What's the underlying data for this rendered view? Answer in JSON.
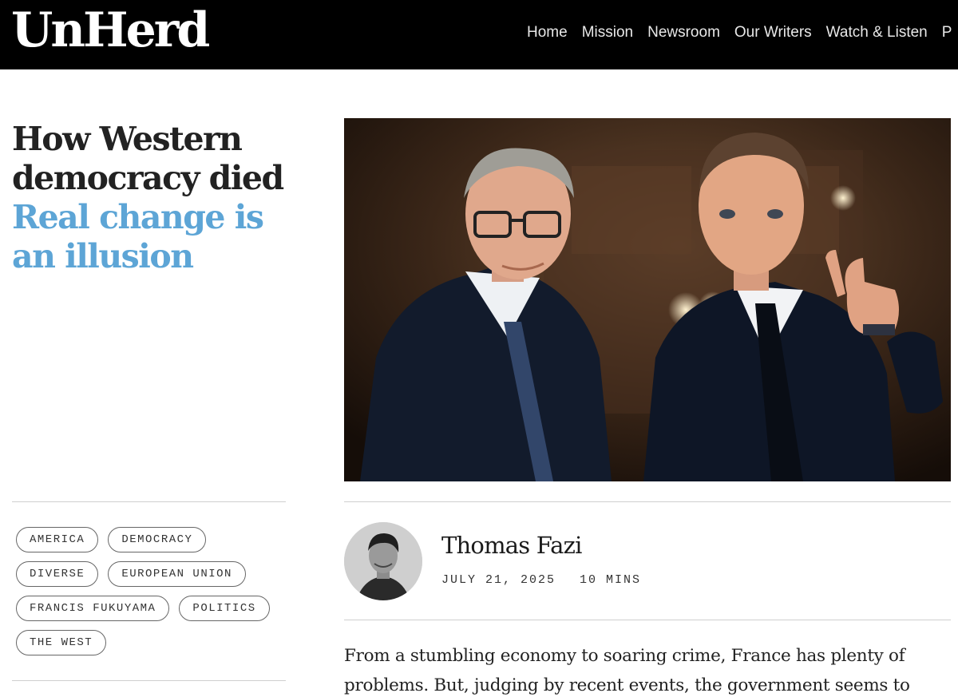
{
  "site": {
    "logo": "UnHerd"
  },
  "nav": {
    "items": [
      "Home",
      "Mission",
      "Newsroom",
      "Our Writers",
      "Watch & Listen",
      "P"
    ]
  },
  "article": {
    "title": "How Western democracy died",
    "subtitle": "Real change is an illusion",
    "tags": [
      "AMERICA",
      "DEMOCRACY",
      "DIVERSE",
      "EUROPEAN UNION",
      "FRANCIS FUKUYAMA",
      "POLITICS",
      "THE WEST"
    ],
    "author": "Thomas Fazi",
    "date": "JULY 21, 2025",
    "read_time": "10 MINS",
    "body": "From a stumbling economy to soaring crime, France has plenty of problems. But, judging by recent events, the government seems to have"
  },
  "colors": {
    "header_bg": "#000000",
    "accent_subtitle": "#5da5d6"
  }
}
